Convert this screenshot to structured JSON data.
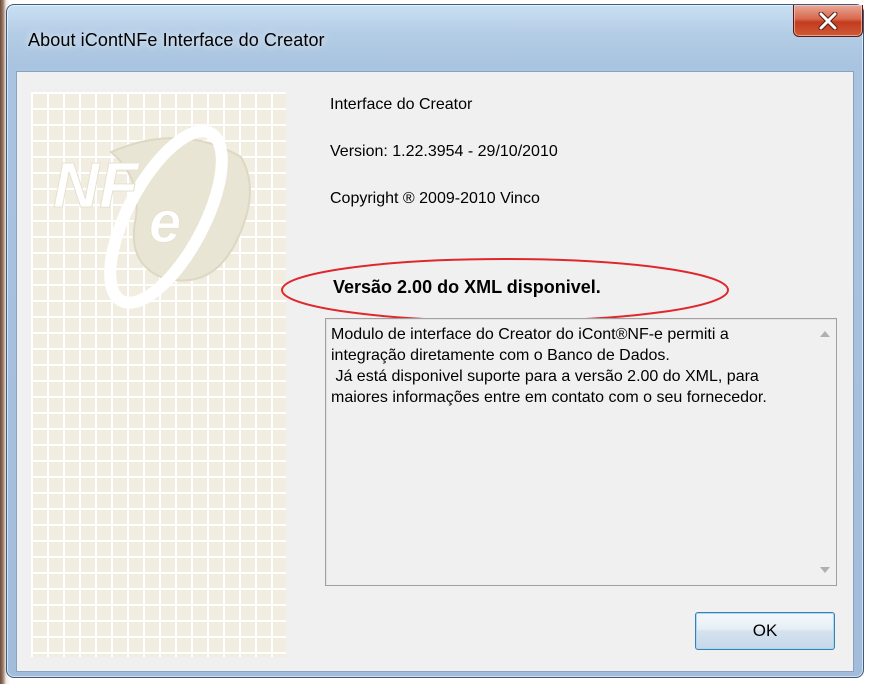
{
  "window": {
    "title": "About iContNFe Interface do Creator"
  },
  "info": {
    "product_name": "Interface do Creator",
    "version": "Version: 1.22.3954 - 29/10/2010",
    "copyright": "Copyright ® 2009-2010 Vinco"
  },
  "highlight": {
    "text": "Versão 2.00 do XML disponivel."
  },
  "description": {
    "text": "Modulo de interface do Creator do iCont®NF-e permiti a integração diretamente com o Banco de Dados.\n Já está disponivel suporte para a versão 2.00 do XML, para maiores informações entre em contato com o seu fornecedor."
  },
  "buttons": {
    "ok_label": "OK"
  },
  "logo": {
    "alt": "NFe"
  },
  "colors": {
    "annotation_red": "#e0272d",
    "close_button": "#c8412a",
    "ok_border": "#3c7fb1",
    "logo_grid_bg": "#f1eee1"
  },
  "icons": {
    "close": "close-icon",
    "scroll_up": "scroll-up-arrow-icon",
    "scroll_down": "scroll-down-arrow-icon"
  }
}
